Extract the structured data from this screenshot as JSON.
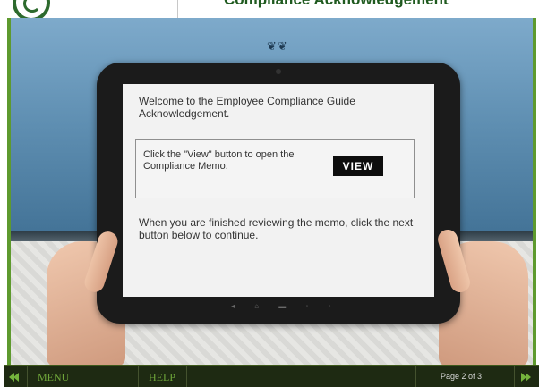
{
  "header": {
    "title": "Compliance Acknowledgement"
  },
  "screen": {
    "intro": "Welcome to the Employee Compliance Guide Acknowledgement.",
    "memo_instruction": "Click the \"View\" button to open the Compliance Memo.",
    "view_button": "VIEW",
    "closing": "When you are finished reviewing the memo, click the next button below to continue."
  },
  "footer": {
    "menu_label": "MENU",
    "help_label": "HELP",
    "page_indicator": "Page 2 of 3",
    "prev_icon": "double-chevron-left-icon",
    "next_icon": "double-chevron-right-icon"
  },
  "colors": {
    "brand_green": "#2d6a2d",
    "footer_bg": "#1e2a12",
    "footer_text": "#6fa63a",
    "button_bg": "#0d0d0d"
  }
}
